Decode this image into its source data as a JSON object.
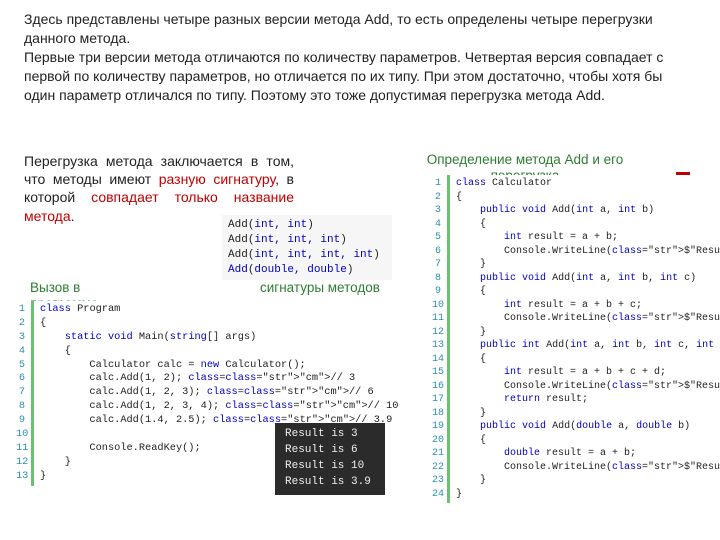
{
  "top_paragraph": "Здесь представлены четыре разных версии метода Add, то есть определены четыре перегрузки данного метода.\nПервые три версии метода отличаются по количеству параметров. Четвертая версия совпадает с первой по количеству параметров, но отличается по их типу. При этом достаточно, чтобы хотя бы один параметр отличался по типу. Поэтому это тоже допустимая перегрузка метода Add.",
  "mid_para": {
    "t1": "Перегрузка метода заключается в том, что методы имеют ",
    "r1": "разную сигнатуру",
    "t2": ", в которой ",
    "r2": "совпадает только название метода",
    "t3": "."
  },
  "labels": {
    "call": "Вызов в программе",
    "sigs": "сигнатуры методов",
    "def": "Определение метода Add и его перегрузка"
  },
  "signatures": [
    {
      "name": "Add",
      "args": "int, int",
      "cls": ""
    },
    {
      "name": "Add",
      "args": "int, int, int",
      "cls": ""
    },
    {
      "name": "Add",
      "args": "int, int, int, int",
      "cls": ""
    },
    {
      "name": "Add",
      "args": "double, double",
      "cls": "kw"
    }
  ],
  "program": {
    "lines_n": [
      "1",
      "2",
      "3",
      "4",
      "5",
      "6",
      "7",
      "8",
      "9",
      "10",
      "11",
      "12",
      "13"
    ],
    "rows": [
      "class Program",
      "{",
      "    static void Main(string[] args)",
      "    {",
      "        Calculator calc = new Calculator();",
      "        calc.Add(1, 2); // 3",
      "        calc.Add(1, 2, 3); // 6",
      "        calc.Add(1, 2, 3, 4); // 10",
      "        calc.Add(1.4, 2.5); // 3.9",
      "",
      "        Console.ReadKey();",
      "    }",
      "}"
    ]
  },
  "calculator": {
    "lines_n": [
      "1",
      "2",
      "3",
      "4",
      "5",
      "6",
      "7",
      "8",
      "9",
      "10",
      "11",
      "12",
      "13",
      "14",
      "15",
      "16",
      "17",
      "18",
      "19",
      "20",
      "21",
      "22",
      "23",
      "24"
    ],
    "rows": [
      "class Calculator",
      "{",
      "    public void Add(int a, int b)",
      "    {",
      "        int result = a + b;",
      "        Console.WriteLine($\"Result is {result}\");",
      "    }",
      "    public void Add(int a, int b, int c)",
      "    {",
      "        int result = a + b + c;",
      "        Console.WriteLine($\"Result is {result}\");",
      "    }",
      "    public int Add(int a, int b, int c, int d)",
      "    {",
      "        int result = a + b + c + d;",
      "        Console.WriteLine($\"Result is {result}\");",
      "        return result;",
      "    }",
      "    public void Add(double a, double b)",
      "    {",
      "        double result = a + b;",
      "        Console.WriteLine($\"Result is {result}\");",
      "    }",
      "}"
    ]
  },
  "output": [
    "Result is 3",
    "Result is 6",
    "Result is 10",
    "Result is 3.9"
  ],
  "syntax": {
    "keywords": [
      "class",
      "public",
      "void",
      "int",
      "static",
      "string",
      "new",
      "return",
      "double"
    ],
    "types": [
      "Program",
      "Main",
      "Calculator",
      "Console",
      "Add",
      "WriteLine",
      "ReadKey"
    ]
  }
}
